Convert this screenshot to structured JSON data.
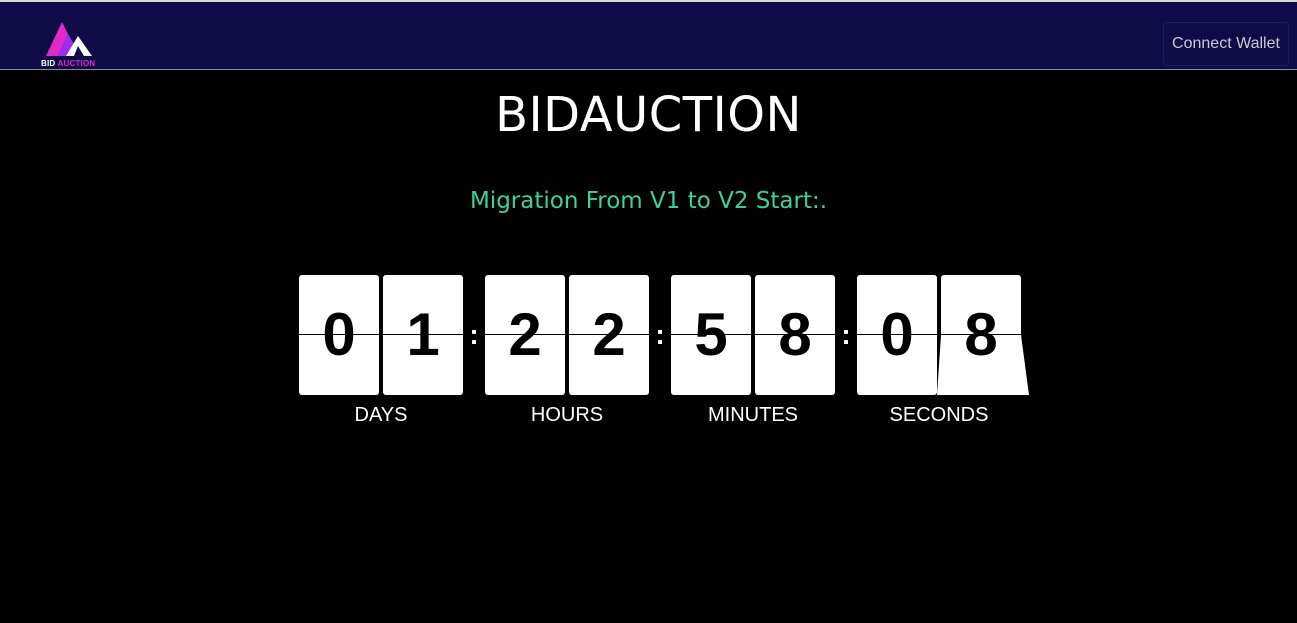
{
  "navbar": {
    "logo": {
      "word1": "BID",
      "word2": "AUCTION",
      "accent_color": "#e229c9",
      "secondary_color": "#7b2ff7"
    },
    "connect_button_label": "Connect Wallet",
    "background_color": "#0e0b47"
  },
  "main": {
    "title": "BIDAUCTION",
    "subtitle": "Migration From V1 to V2 Start:.",
    "subtitle_color": "#3fd19d"
  },
  "countdown": {
    "separator": ":",
    "groups": [
      {
        "label": "DAYS",
        "digits": [
          "0",
          "1"
        ]
      },
      {
        "label": "HOURS",
        "digits": [
          "2",
          "2"
        ]
      },
      {
        "label": "MINUTES",
        "digits": [
          "5",
          "8"
        ]
      },
      {
        "label": "SECONDS",
        "digits": [
          "0",
          "8"
        ]
      }
    ]
  }
}
